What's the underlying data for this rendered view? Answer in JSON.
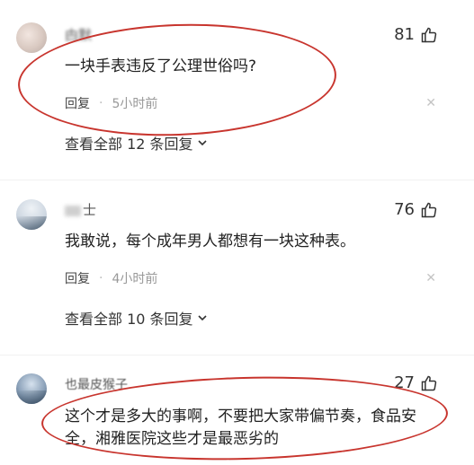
{
  "comments": [
    {
      "username": "甴默",
      "likes": "81",
      "text": "一块手表违反了公理世俗吗?",
      "reply_label": "回复",
      "time": "5小时前",
      "view_all": "查看全部 12 条回复"
    },
    {
      "username": "士",
      "likes": "76",
      "text": "我敢说，每个成年男人都想有一块这种表。",
      "reply_label": "回复",
      "time": "4小时前",
      "view_all": "查看全部 10 条回复"
    },
    {
      "username": "也最皮猴子",
      "likes": "27",
      "text_line1": "这个才是多大的事啊，不要把大家带偏节奏，食品安",
      "text_line2": "全，湘雅医院这些才是最恶劣的"
    }
  ],
  "separator": "·",
  "close_glyph": "✕",
  "colors": {
    "annotation": "#c8352e"
  }
}
